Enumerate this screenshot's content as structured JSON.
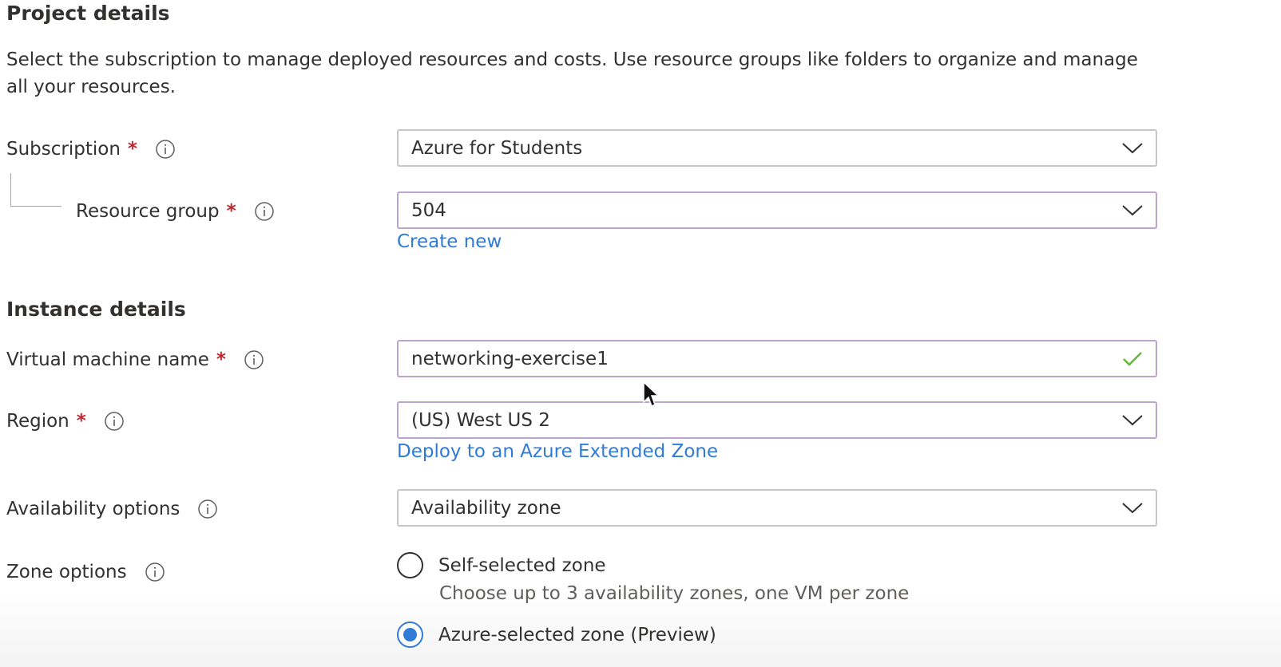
{
  "project_details": {
    "heading": "Project details",
    "description": "Select the subscription to manage deployed resources and costs. Use resource groups like folders to organize and manage all your resources."
  },
  "subscription": {
    "label": "Subscription",
    "required_marker": "*",
    "value": "Azure for Students"
  },
  "resource_group": {
    "label": "Resource group",
    "required_marker": "*",
    "value": "504",
    "create_new_link": "Create new"
  },
  "instance_details": {
    "heading": "Instance details"
  },
  "vm_name": {
    "label": "Virtual machine name",
    "required_marker": "*",
    "value": "networking-exercise1"
  },
  "region": {
    "label": "Region",
    "required_marker": "*",
    "value": "(US) West US 2",
    "extended_zone_link": "Deploy to an Azure Extended Zone"
  },
  "availability": {
    "label": "Availability options",
    "value": "Availability zone"
  },
  "zone_options": {
    "label": "Zone options",
    "options": [
      {
        "label": "Self-selected zone",
        "help": "Choose up to 3 availability zones, one VM per zone",
        "checked": false
      },
      {
        "label": "Azure-selected zone (Preview)",
        "checked": true
      }
    ]
  },
  "colors": {
    "required": "#c4262e",
    "link": "#2f7bd6",
    "focus_border": "#b9a5cf",
    "valid_check": "#5fb832"
  },
  "icons": {
    "info": "info-icon",
    "dropdown": "chevron-down-icon",
    "valid": "checkmark-icon",
    "pointer": "mouse-cursor-icon"
  }
}
